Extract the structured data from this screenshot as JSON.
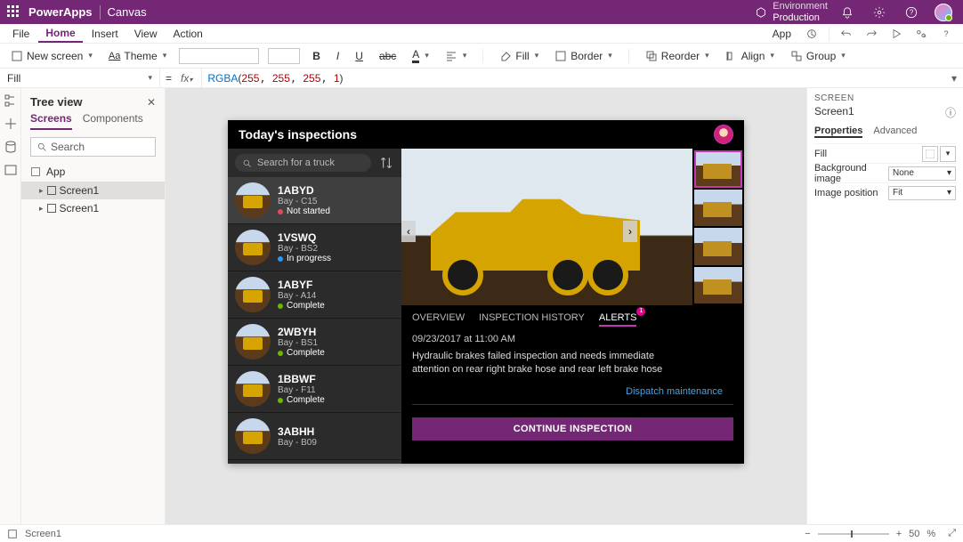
{
  "titlebar": {
    "brand": "PowerApps",
    "docname": "Canvas",
    "env_label": "Environment",
    "env_value": "Production"
  },
  "menubar": {
    "items": [
      "File",
      "Home",
      "Insert",
      "View",
      "Action"
    ],
    "active_index": 1,
    "app_label": "App"
  },
  "ribbon": {
    "newscreen": "New screen",
    "theme": "Theme",
    "fill": "Fill",
    "border": "Border",
    "reorder": "Reorder",
    "align": "Align",
    "group": "Group"
  },
  "formula": {
    "property": "Fill",
    "fn": "RGBA",
    "args": [
      "255",
      "255",
      "255",
      "1"
    ]
  },
  "tree": {
    "title": "Tree view",
    "tabs": [
      "Screens",
      "Components"
    ],
    "active_tab": 0,
    "search_placeholder": "Search",
    "app_label": "App",
    "nodes": [
      "Screen1",
      "Screen1"
    ],
    "selected_index": 0
  },
  "app": {
    "header_title": "Today's inspections",
    "search_placeholder": "Search for a truck",
    "trucks": [
      {
        "name": "1ABYD",
        "bay": "Bay - C15",
        "status_label": "Not started",
        "status": "red"
      },
      {
        "name": "1VSWQ",
        "bay": "Bay - BS2",
        "status_label": "In progress",
        "status": "blue"
      },
      {
        "name": "1ABYF",
        "bay": "Bay - A14",
        "status_label": "Complete",
        "status": "green"
      },
      {
        "name": "2WBYH",
        "bay": "Bay - BS1",
        "status_label": "Complete",
        "status": "green"
      },
      {
        "name": "1BBWF",
        "bay": "Bay - F11",
        "status_label": "Complete",
        "status": "green"
      },
      {
        "name": "3ABHH",
        "bay": "Bay - B09",
        "status_label": "",
        "status": ""
      }
    ],
    "selected_truck_index": 0,
    "detail_tabs": [
      "OVERVIEW",
      "INSPECTION HISTORY",
      "ALERTS"
    ],
    "detail_active": 2,
    "alert_badge": "1",
    "alert_time": "09/23/2017 at 11:00 AM",
    "alert_text": "Hydraulic brakes failed inspection and needs immediate attention on rear right brake hose and rear left brake hose",
    "dispatch_label": "Dispatch maintenance",
    "continue_label": "CONTINUE INSPECTION",
    "thumb_selected": 0
  },
  "rightpane": {
    "section_label": "SCREEN",
    "screen_name": "Screen1",
    "tabs": [
      "Properties",
      "Advanced"
    ],
    "active_tab": 0,
    "props": {
      "fill_label": "Fill",
      "bgimg_label": "Background image",
      "bgimg_value": "None",
      "imgpos_label": "Image position",
      "imgpos_value": "Fit"
    }
  },
  "statusbar": {
    "screen_label": "Screen1",
    "zoom_value": "50",
    "zoom_unit": "%"
  }
}
